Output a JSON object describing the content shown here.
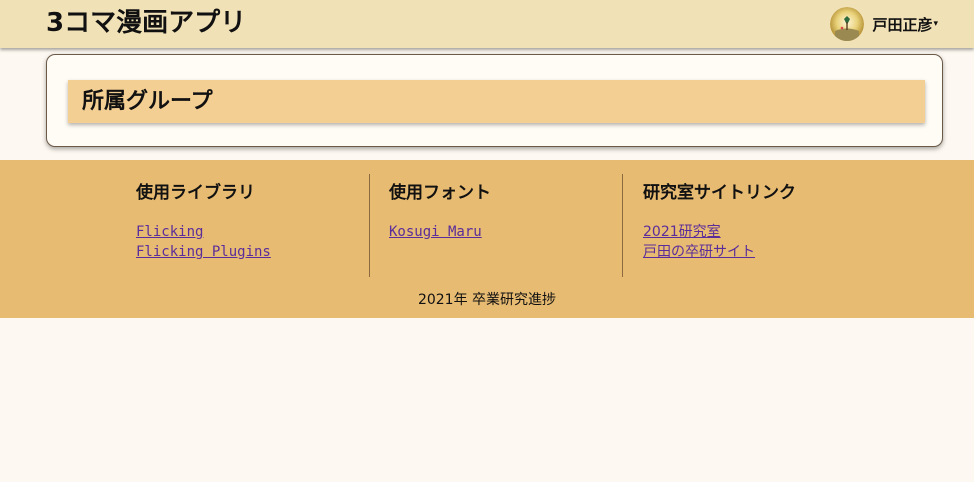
{
  "header": {
    "app_title": "3コマ漫画アプリ",
    "user_name": "戸田正彦",
    "user_menu_caret": "▾",
    "avatar_icon": "user-avatar-icon"
  },
  "card": {
    "heading": "所属グループ"
  },
  "footer": {
    "columns": [
      {
        "heading": "使用ライブラリ",
        "links": [
          "Flicking",
          "Flicking Plugins"
        ]
      },
      {
        "heading": "使用フォント",
        "links": [
          "Kosugi Maru"
        ]
      },
      {
        "heading": "研究室サイトリンク",
        "links": [
          "2021研究室",
          "戸田の卒研サイト"
        ]
      }
    ],
    "copyright": "2021年 卒業研究進捗"
  },
  "colors": {
    "header_bg": "#f1e1b6",
    "page_bg": "#fdf8f1",
    "card_heading_bg": "#f4cf93",
    "footer_bg": "#e8bb72",
    "link": "#5a2d9a"
  }
}
